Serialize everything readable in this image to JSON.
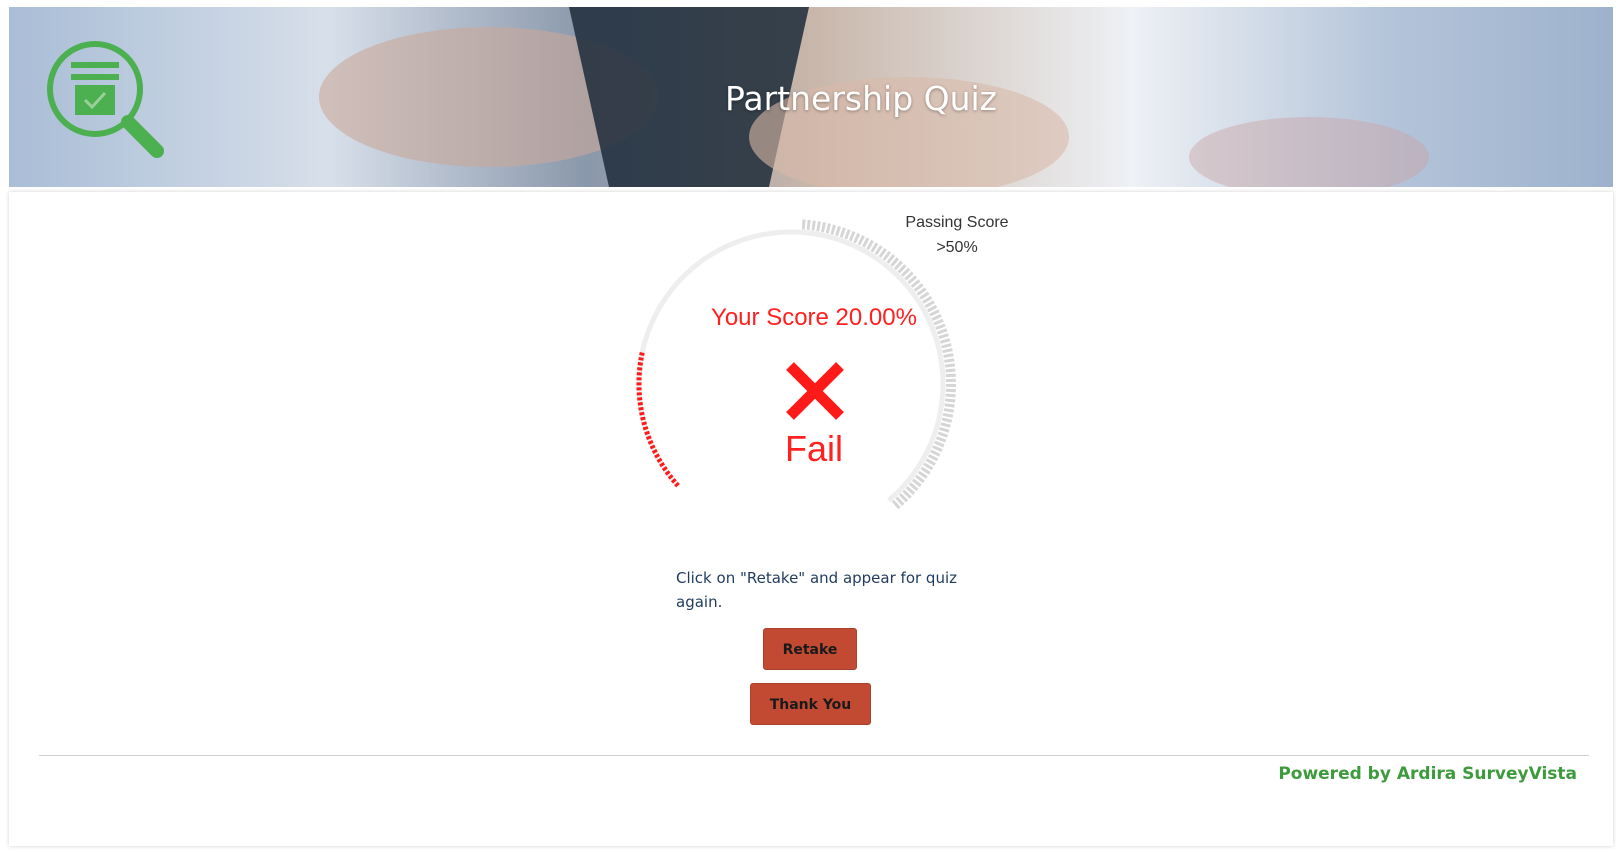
{
  "header": {
    "title": "Partnership Quiz",
    "logo_icon": "quiz-search-icon",
    "logo_color": "#4caf50"
  },
  "result": {
    "passing_label": "Passing Score",
    "passing_value": ">50%",
    "passing_threshold": 0.5,
    "score_text": "Your Score 20.00%",
    "score_fraction": 0.2,
    "status_icon": "fail-x-icon",
    "status_text": "Fail",
    "status_color": "#ff1a1a",
    "message": "Click on \"Retake\" and appear for quiz again."
  },
  "actions": {
    "retake_label": "Retake",
    "thank_you_label": "Thank You",
    "button_color": "#c24a33"
  },
  "footer": {
    "powered_by": "Powered by Ardira SurveyVista",
    "powered_color": "#3d9a3d"
  }
}
